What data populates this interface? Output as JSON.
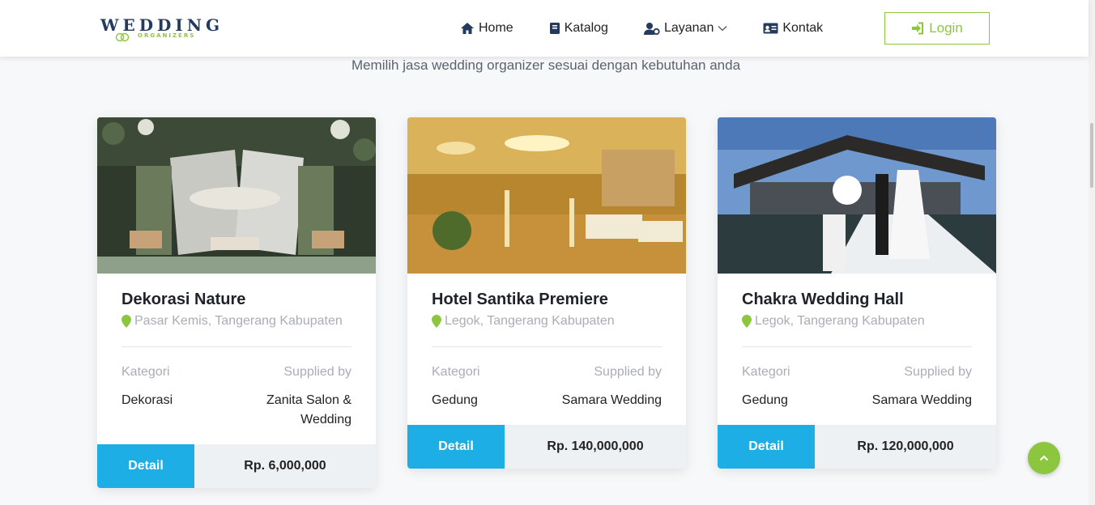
{
  "header": {
    "logo_text": "WEDDING",
    "logo_sub": "ORGANIZERS",
    "nav": [
      {
        "label": "Home",
        "icon": "home-icon"
      },
      {
        "label": "Katalog",
        "icon": "book-icon"
      },
      {
        "label": "Layanan",
        "icon": "user-cog-icon"
      },
      {
        "label": "Kontak",
        "icon": "id-card-icon"
      }
    ],
    "login_label": "Login"
  },
  "subtitle": "Memilih jasa wedding organizer sesuai dengan kebutuhan anda",
  "labels": {
    "kategori": "Kategori",
    "supplied_by": "Supplied by",
    "detail": "Detail"
  },
  "cards": [
    {
      "title": "Dekorasi Nature",
      "location": "Pasar Kemis, Tangerang Kabupaten",
      "kategori": "Dekorasi",
      "supplier": "Zanita Salon & Wedding",
      "price": "Rp. 6,000,000"
    },
    {
      "title": "Hotel Santika Premiere",
      "location": "Legok, Tangerang Kabupaten",
      "kategori": "Gedung",
      "supplier": "Samara Wedding",
      "price": "Rp. 140,000,000"
    },
    {
      "title": "Chakra Wedding Hall",
      "location": "Legok, Tangerang Kabupaten",
      "kategori": "Gedung",
      "supplier": "Samara Wedding",
      "price": "Rp. 120,000,000"
    }
  ],
  "colors": {
    "brand_green": "#8cc63f",
    "detail_blue": "#1eaee6",
    "logo_navy": "#243a5e"
  }
}
